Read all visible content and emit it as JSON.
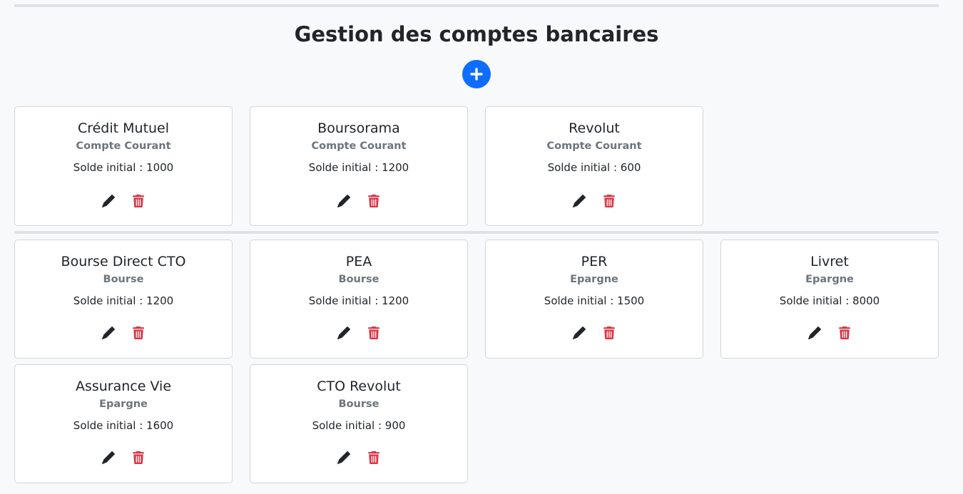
{
  "header": {
    "title": "Gestion des comptes bancaires",
    "add_icon": "plus-icon",
    "accent_color": "#0d6efd"
  },
  "balance_prefix": "Solde initial : ",
  "icons": {
    "edit": "pencil-icon",
    "delete": "trash-icon",
    "delete_color": "#dc3545"
  },
  "accounts": [
    {
      "name": "Crédit Mutuel",
      "type": "Compte Courant",
      "balance": "Solde initial : 1000"
    },
    {
      "name": "Boursorama",
      "type": "Compte Courant",
      "balance": "Solde initial : 1200"
    },
    {
      "name": "Revolut",
      "type": "Compte Courant",
      "balance": "Solde initial : 600"
    },
    {
      "name": "Bourse Direct CTO",
      "type": "Bourse",
      "balance": "Solde initial : 1200"
    },
    {
      "name": "PEA",
      "type": "Bourse",
      "balance": "Solde initial : 1200"
    },
    {
      "name": "PER",
      "type": "Epargne",
      "balance": "Solde initial : 1500"
    },
    {
      "name": "Livret",
      "type": "Epargne",
      "balance": "Solde initial : 8000"
    },
    {
      "name": "Assurance Vie",
      "type": "Epargne",
      "balance": "Solde initial : 1600"
    },
    {
      "name": "CTO Revolut",
      "type": "Bourse",
      "balance": "Solde initial : 900"
    }
  ]
}
